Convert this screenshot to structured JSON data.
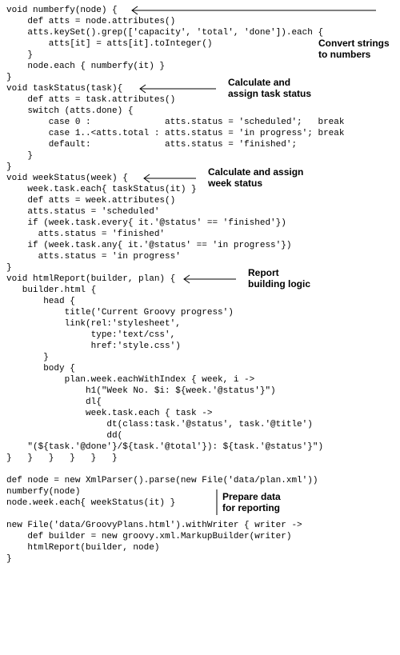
{
  "code_lines": [
    "void numberfy(node) {",
    "    def atts = node.attributes()",
    "    atts.keySet().grep(['capacity', 'total', 'done']).each {",
    "        atts[it] = atts[it].toInteger()",
    "    }",
    "    node.each { numberfy(it) }",
    "}",
    "void taskStatus(task){",
    "    def atts = task.attributes()",
    "    switch (atts.done) {",
    "        case 0 :              atts.status = 'scheduled';   break",
    "        case 1..<atts.total : atts.status = 'in progress'; break",
    "        default:              atts.status = 'finished';",
    "    }",
    "}",
    "void weekStatus(week) {",
    "    week.task.each{ taskStatus(it) }",
    "    def atts = week.attributes()",
    "    atts.status = 'scheduled'",
    "    if (week.task.every{ it.'@status' == 'finished'})",
    "      atts.status = 'finished'",
    "    if (week.task.any{ it.'@status' == 'in progress'})",
    "      atts.status = 'in progress'",
    "}",
    "void htmlReport(builder, plan) {",
    "   builder.html {",
    "       head {",
    "           title('Current Groovy progress')",
    "           link(rel:'stylesheet',",
    "                type:'text/css',",
    "                href:'style.css')",
    "       }",
    "       body {",
    "           plan.week.eachWithIndex { week, i ->",
    "               h1(\"Week No. $i: ${week.'@status'}\")",
    "               dl{",
    "               week.task.each { task ->",
    "                   dt(class:task.'@status', task.'@title')",
    "                   dd(",
    "    \"(${task.'@done'}/${task.'@total'}): ${task.'@status'}\")",
    "}   }   }   }   }   }",
    "",
    "def node = new XmlParser().parse(new File('data/plan.xml'))",
    "numberfy(node)",
    "node.week.each{ weekStatus(it) }",
    "",
    "new File('data/GroovyPlans.html').withWriter { writer ->",
    "    def builder = new groovy.xml.MarkupBuilder(writer)",
    "    htmlReport(builder, node)",
    "}"
  ],
  "labels": {
    "convert": "Convert strings\nto numbers",
    "task": "Calculate and\nassign task status",
    "week": "Calculate and assign\nweek status",
    "report": "Report\nbuilding logic",
    "prepare": "Prepare data\nfor reporting"
  }
}
